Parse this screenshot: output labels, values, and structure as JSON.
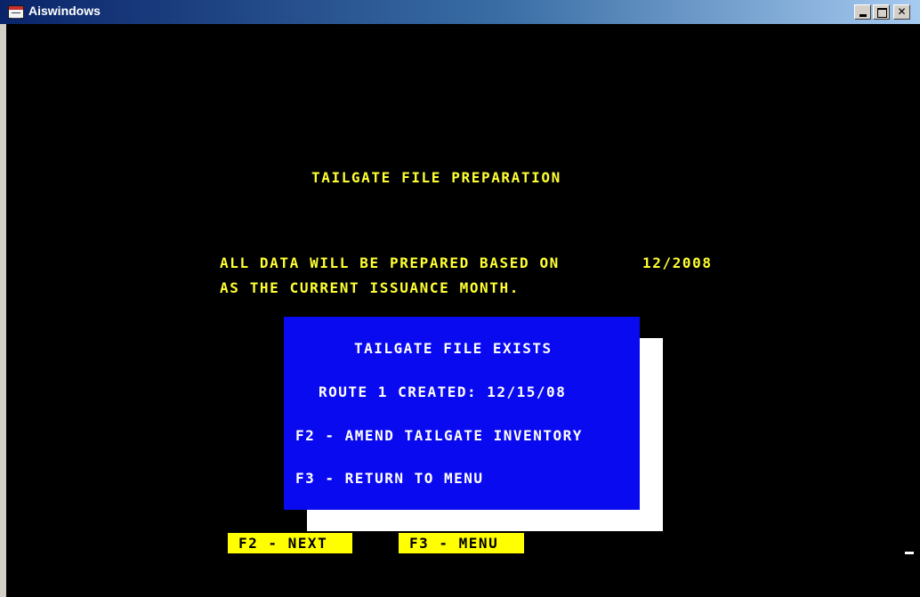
{
  "window": {
    "title": "Aiswindows",
    "icon": "window-app-icon",
    "controls": [
      "minimize-icon",
      "maximize-icon",
      "close-icon"
    ]
  },
  "screen": {
    "heading": "TAILGATE FILE PREPARATION",
    "message_line1": "ALL DATA WILL BE PREPARED BASED ON",
    "month": "12/2008",
    "message_line2": "AS THE CURRENT ISSUANCE MONTH."
  },
  "dialog": {
    "title": "TAILGATE FILE EXISTS",
    "route_info": "ROUTE 1 CREATED: 12/15/08",
    "option_f2": "F2 - AMEND TAILGATE INVENTORY",
    "option_f3": "F3 - RETURN TO MENU"
  },
  "function_keys": {
    "f2": "F2 - NEXT",
    "f3": "F3 - MENU"
  },
  "colors": {
    "background": "#000000",
    "text": "#ffff33",
    "dialog": "#0a0af0",
    "dialog_shadow": "#ffffff",
    "fkey": "#ffff00"
  }
}
